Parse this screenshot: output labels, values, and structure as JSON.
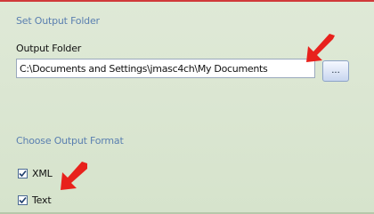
{
  "output_folder_section": {
    "title": "Set Output Folder",
    "field_label": "Output Folder",
    "path_value": "C:\\Documents and Settings\\jmasc4ch\\My Documents",
    "browse_label": "..."
  },
  "output_format_section": {
    "title": "Choose Output Format",
    "options": [
      {
        "label": "XML",
        "checked": true
      },
      {
        "label": "Text",
        "checked": true
      }
    ]
  },
  "colors": {
    "section_title": "#5a7fb0",
    "panel_background": "#d9e5cf",
    "annotation_arrow": "#e8211c"
  },
  "icons": {
    "annotation": "red-arrow-icon",
    "check": "checkmark-icon"
  }
}
